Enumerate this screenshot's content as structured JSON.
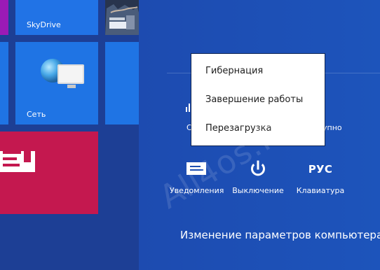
{
  "start": {
    "tiles": {
      "skydrive": {
        "label": "SkyDrive"
      },
      "network": {
        "label": "Сеть"
      }
    }
  },
  "power_menu": {
    "items": [
      {
        "label": "Гибернация"
      },
      {
        "label": "Завершение работы"
      },
      {
        "label": "Перезагрузка"
      }
    ]
  },
  "settings": {
    "clipped_left": "С",
    "clipped_right": "упно",
    "bottom_items": [
      {
        "label": "Уведомления",
        "icon": "notifications-icon"
      },
      {
        "label": "Выключение",
        "icon": "power-icon"
      },
      {
        "label": "Клавиатура",
        "icon": "keyboard-icon",
        "icon_text": "РУС"
      }
    ],
    "change_settings_link": "Изменение параметров компьютера"
  },
  "watermark": "All4os.RU",
  "colors": {
    "background": "#1f4fae",
    "tile_blue": "#1f74e4",
    "tile_red": "#c4184f",
    "tile_purple": "#9b1ab6",
    "menu_bg": "#ffffff"
  }
}
